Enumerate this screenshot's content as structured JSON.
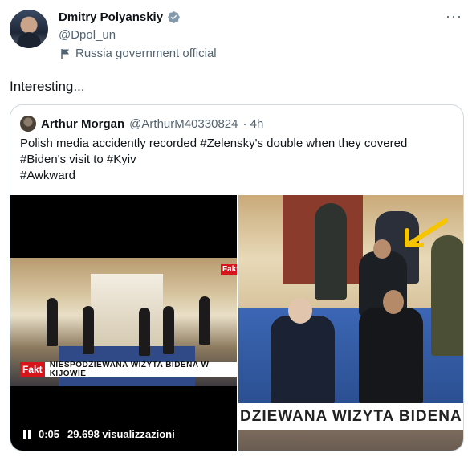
{
  "author": {
    "name": "Dmitry Polyanskiy",
    "handle": "@Dpol_un",
    "label": "Russia government official"
  },
  "tweet": {
    "text": "Interesting..."
  },
  "quoted": {
    "name": "Arthur Morgan",
    "handle": "@ArthurM40330824",
    "time": "· 4h",
    "line1": "Polish media accidently recorded #Zelensky's double when they covered",
    "line2": "#Biden's visit to #Kyiv",
    "line3": "#Awkward"
  },
  "video": {
    "brand": "Fakt",
    "caption": "NIESPODZIEWANA WIZYTA BIDENA W KIJOWIE",
    "time": "0:05",
    "views": "29.698 visualizzazioni"
  },
  "photo": {
    "caption": "DZIEWANA WIZYTA BIDENA W"
  },
  "colors": {
    "verified": "#829aab",
    "secondary": "#536471",
    "border": "#cfd9de",
    "arrow": "#f6c400"
  }
}
